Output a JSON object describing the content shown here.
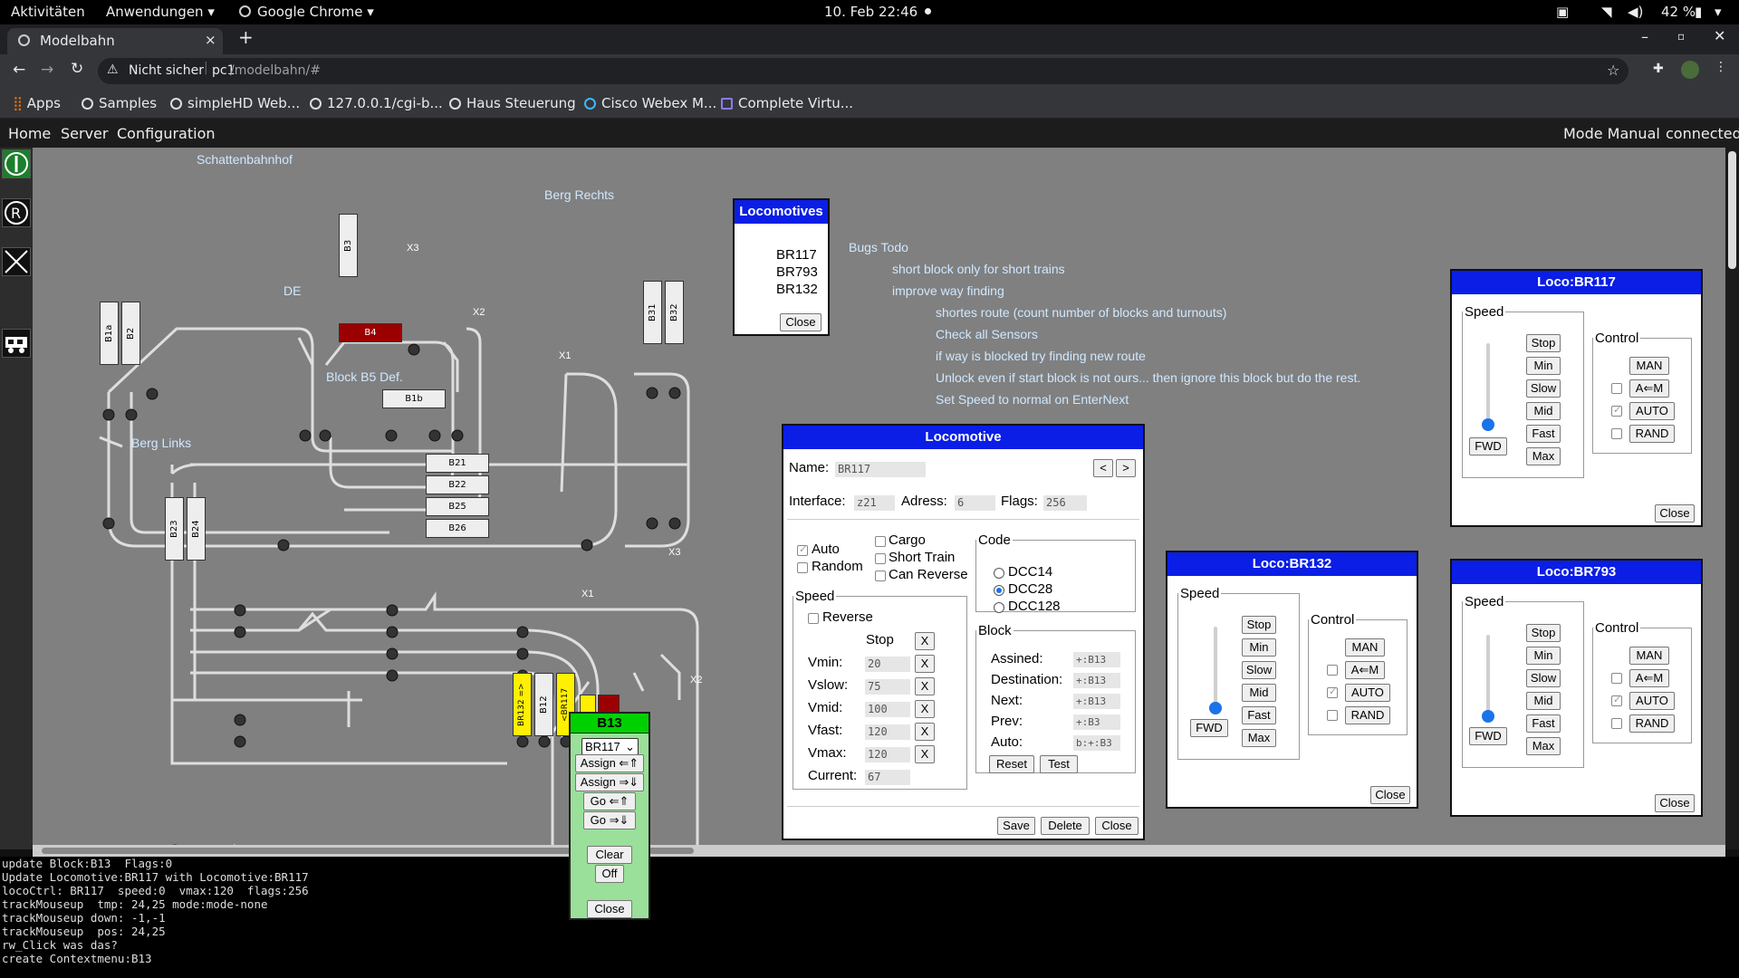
{
  "gnome": {
    "activities": "Aktivitäten",
    "apps": "Anwendungen ▾",
    "browser": "Google Chrome ▾",
    "clock": "10. Feb 22:46",
    "battery": "42 %"
  },
  "chrome": {
    "tab_title": "Modelbahn",
    "security": "Nicht sicher",
    "url_host": "pc1",
    "url_path": "/modelbahn/#",
    "bookmarks": [
      "Apps",
      "Samples",
      "simpleHD Web...",
      "127.0.0.1/cgi-b...",
      "Haus Steuerung",
      "Cisco Webex M...",
      "Complete Virtu..."
    ]
  },
  "menu": {
    "home": "Home",
    "server": "Server",
    "configuration": "Configuration",
    "mode": "Mode Manual",
    "status": "connected"
  },
  "layout": {
    "labels": {
      "schattenbahnhof": "Schattenbahnhof",
      "berg_rechts": "Berg Rechts",
      "berg_links": "Berg Links",
      "block_b5": "Block B5 Def.",
      "de": "DE"
    },
    "turnouts": {
      "x3a": "X3",
      "x2a": "X2",
      "x1a": "X1",
      "x3b": "X3",
      "x1b": "X1",
      "x2b": "X2"
    },
    "blocks": {
      "b3": "B3",
      "b1a": "B1a",
      "b2": "B2",
      "b4": "B4",
      "b1b": "B1b",
      "b31": "B31",
      "b32": "B32",
      "b21": "B21",
      "b22": "B22",
      "b25": "B25",
      "b26": "B26",
      "b23": "B23",
      "b24": "B24",
      "b132": "BR132 =>",
      "b12": "B12",
      "b117": "<BR117"
    }
  },
  "bugs": {
    "title": "Bugs Todo",
    "items": [
      "short block only for short trains",
      "improve way finding",
      "shortes route (count number of blocks and turnouts)",
      "Check all Sensors",
      "if way is blocked try finding new route",
      "Unlock even if start block is not ours... then ignore this block but do the rest.",
      "Set Speed to normal on EnterNext"
    ]
  },
  "locolist": {
    "title": "Locomotives",
    "items": [
      "BR117",
      "BR793",
      "BR132"
    ],
    "close": "Close"
  },
  "loco_editor": {
    "title": "Locomotive",
    "name_label": "Name:",
    "name": "BR117",
    "prev": "<",
    "next": ">",
    "interface_label": "Interface:",
    "interface": "z21",
    "adress_label": "Adress:",
    "adress": "6",
    "flags_label": "Flags:",
    "flags": "256",
    "auto": "Auto",
    "random": "Random",
    "cargo": "Cargo",
    "short_train": "Short Train",
    "can_reverse": "Can Reverse",
    "code_legend": "Code",
    "dcc14": "DCC14",
    "dcc28": "DCC28",
    "dcc128": "DCC128",
    "speed_legend": "Speed",
    "reverse": "Reverse",
    "stop": "Stop",
    "x": "X",
    "vmin_label": "Vmin:",
    "vmin": "20",
    "vslow_label": "Vslow:",
    "vslow": "75",
    "vmid_label": "Vmid:",
    "vmid": "100",
    "vfast_label": "Vfast:",
    "vfast": "120",
    "vmax_label": "Vmax:",
    "vmax": "120",
    "current_label": "Current:",
    "current": "67",
    "block_legend": "Block",
    "assined_label": "Assined:",
    "assined": "+:B13",
    "destination_label": "Destination:",
    "destination": "+:B13",
    "next_label": "Next:",
    "next_val": "+:B13",
    "prev_label": "Prev:",
    "prev_val": "+:B3",
    "auto_label": "Auto:",
    "auto_val": "b:+:B3",
    "reset": "Reset",
    "test": "Test",
    "save": "Save",
    "delete": "Delete",
    "close": "Close"
  },
  "loco_ctrl": {
    "speed": "Speed",
    "control": "Control",
    "stop": "Stop",
    "min": "Min",
    "slow": "Slow",
    "mid": "Mid",
    "fast": "Fast",
    "max": "Max",
    "fwd": "FWD",
    "man": "MAN",
    "aem": "A⇐M",
    "auto": "AUTO",
    "rand": "RAND",
    "close": "Close",
    "br117": {
      "title": "Loco:BR117",
      "speed_fraction": 0.0
    },
    "br132": {
      "title": "Loco:BR132",
      "speed_fraction": 0.0
    },
    "br793": {
      "title": "Loco:BR793",
      "speed_fraction": 0.0
    }
  },
  "context": {
    "title": "B13",
    "select": "BR117",
    "assign_left": "Assign ⇐⇑",
    "assign_right": "Assign ⇒⇓",
    "go_left": "Go ⇐⇑",
    "go_right": "Go ⇒⇓",
    "clear": "Clear",
    "off": "Off",
    "close": "Close"
  },
  "console": [
    "update Block:B13  Flags:0",
    "Update Locomotive:BR117 with Locomotive:BR117",
    "locoCtrl: BR117  speed:0  vmax:120  flags:256",
    "trackMouseup  tmp: 24,25 mode:mode-none",
    "trackMouseup down: -1,-1",
    "trackMouseup  pos: 24,25",
    "rw_Click was das?",
    "create Contextmenu:B13"
  ]
}
